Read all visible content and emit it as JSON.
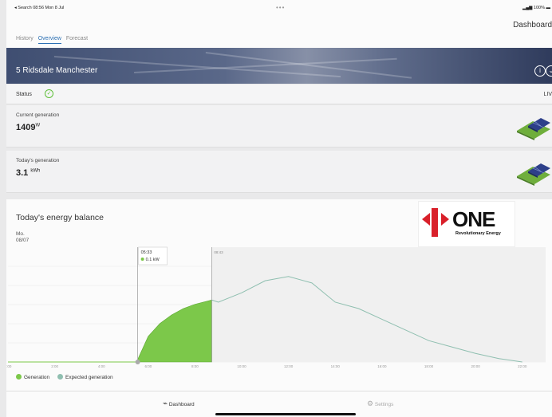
{
  "status_bar": {
    "left": "◂ Search  08:56  Mon 8 Jul",
    "dots": "•••",
    "right": "100%"
  },
  "header": {
    "title": "Dashboard",
    "tabs": [
      "History",
      "Overview",
      "Forecast"
    ],
    "active_tab": "Overview"
  },
  "banner": {
    "address": "5 Ridsdale Manchester"
  },
  "status": {
    "label": "Status",
    "live_label": "LIV"
  },
  "current_generation": {
    "label": "Current generation",
    "value": "1409",
    "unit": "W"
  },
  "todays_generation": {
    "label": "Today's generation",
    "value": "3.1",
    "unit": "kWh"
  },
  "energy_balance": {
    "title": "Today's energy balance",
    "day": "Mo.",
    "date": "08/07",
    "logo_text": "ONE",
    "logo_sub": "Revolutionary Energy",
    "tooltip_time": "05:33",
    "tooltip_value": "0.1 kW",
    "now_time": "08:43"
  },
  "chart_data": {
    "type": "area",
    "x_ticks": [
      "0:00",
      "2:00",
      "4:00",
      "6:00",
      "8:00",
      "10:00",
      "12:00",
      "14:00",
      "16:00",
      "18:00",
      "20:00",
      "22:00"
    ],
    "series": [
      {
        "name": "Generation",
        "color": "#7cc84a",
        "x": [
          "05:30",
          "06:00",
          "06:30",
          "07:00",
          "07:30",
          "08:00",
          "08:43"
        ],
        "values": [
          0.0,
          0.6,
          0.9,
          1.1,
          1.25,
          1.35,
          1.45
        ]
      },
      {
        "name": "Expected generation",
        "color": "#8fbfb0",
        "x": [
          "08:43",
          "09:00",
          "10:00",
          "11:00",
          "12:00",
          "13:00",
          "14:00",
          "15:00",
          "16:00",
          "17:00",
          "18:00",
          "19:00",
          "20:00",
          "21:00",
          "22:00"
        ],
        "values": [
          1.45,
          1.4,
          1.62,
          1.9,
          2.0,
          1.85,
          1.4,
          1.25,
          1.0,
          0.75,
          0.5,
          0.35,
          0.2,
          0.08,
          0.0
        ]
      }
    ],
    "legend": [
      "Generation",
      "Expected generation"
    ],
    "legend_position": "bottom-left",
    "grid": true
  },
  "bottom_nav": {
    "dashboard": "Dashboard",
    "settings": "Settings"
  }
}
